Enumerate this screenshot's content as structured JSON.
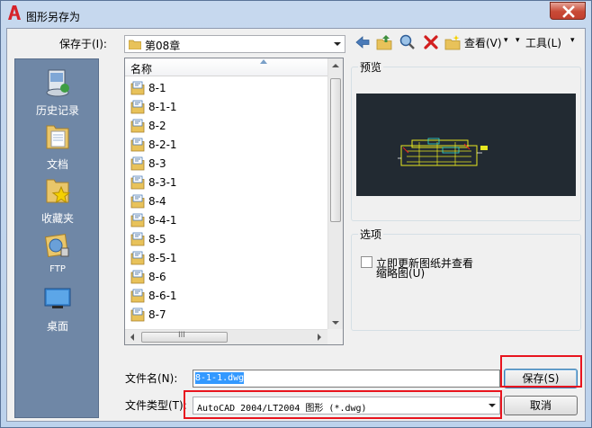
{
  "window": {
    "title": "图形另存为"
  },
  "save_in": {
    "label": "保存于(I):",
    "value": "第08章"
  },
  "toolbar": {
    "back_icon": "back-arrow-icon",
    "up_icon": "up-folder-icon",
    "search_web_icon": "search-web-icon",
    "delete_icon": "delete-icon",
    "new_folder_icon": "new-folder-icon",
    "views_label": "查看(V)",
    "tools_label": "工具(L)"
  },
  "places": [
    {
      "label": "历史记录",
      "icon": "history-icon"
    },
    {
      "label": "文档",
      "icon": "documents-icon"
    },
    {
      "label": "收藏夹",
      "icon": "favorites-icon"
    },
    {
      "label": "FTP",
      "icon": "ftp-icon"
    },
    {
      "label": "桌面",
      "icon": "desktop-icon"
    }
  ],
  "file_list": {
    "column_header": "名称",
    "items": [
      "8-1",
      "8-1-1",
      "8-2",
      "8-2-1",
      "8-3",
      "8-3-1",
      "8-4",
      "8-4-1",
      "8-5",
      "8-5-1",
      "8-6",
      "8-6-1",
      "8-7"
    ],
    "hscroll_grip": "III"
  },
  "preview": {
    "label": "预览"
  },
  "options": {
    "label": "选项",
    "update_thumbnail_label_line1": "立即更新图纸并查看",
    "update_thumbnail_label_line2": "缩略图(U)",
    "checked": false
  },
  "filename": {
    "label": "文件名(N):",
    "value": "8-1-1.dwg"
  },
  "filetype": {
    "label": "文件类型(T):",
    "value": "AutoCAD 2004/LT2004 图形 (*.dwg)"
  },
  "buttons": {
    "save": "保存(S)",
    "cancel": "取消"
  },
  "colors": {
    "highlight_box": "#e8141e",
    "places_bar": "#6f87a6",
    "preview_bg": "#222a32"
  }
}
